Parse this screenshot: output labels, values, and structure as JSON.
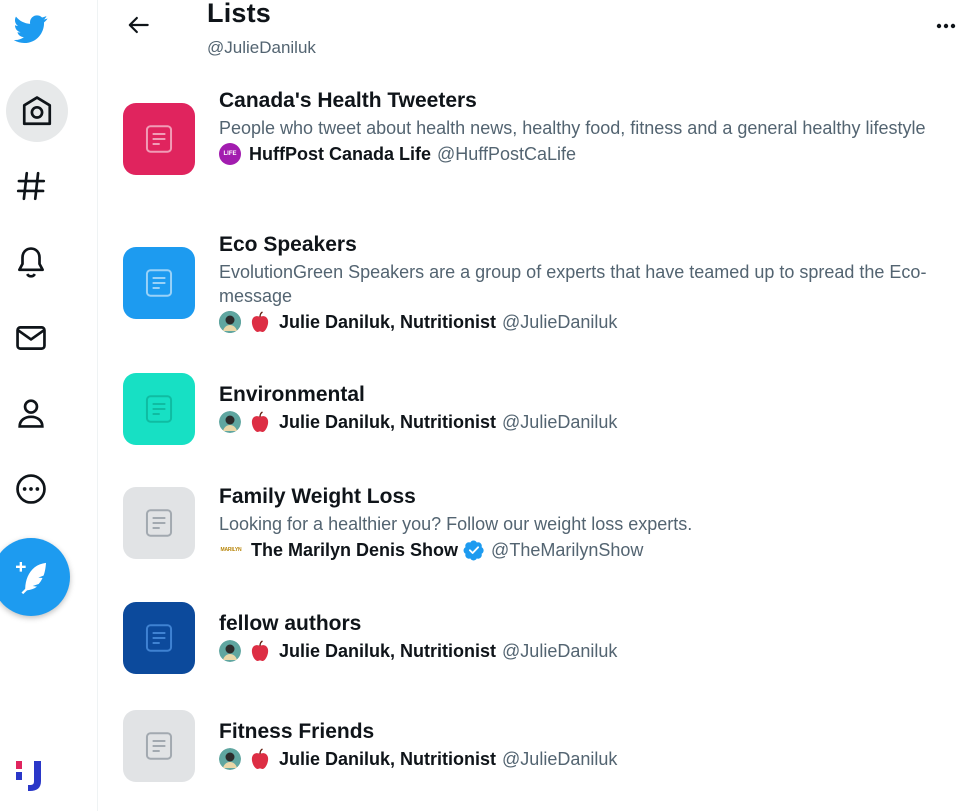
{
  "header": {
    "title": "Lists",
    "handle": "@JulieDaniluk"
  },
  "nav": {
    "items": [
      "twitter-logo",
      "home",
      "explore",
      "notifications",
      "messages",
      "profile",
      "more"
    ]
  },
  "colors": {
    "accent": "#1d9bf0",
    "thumb_pink": "#e0245e",
    "thumb_blue": "#1d9bf0",
    "thumb_teal": "#17e0c4",
    "thumb_gray": "#e1e3e5",
    "thumb_navy": "#0c4a9c"
  },
  "lists": [
    {
      "name": "Canada's Health Tweeters",
      "description": "People who tweet about health news, healthy food, fitness and a general healthy lifestyle",
      "owner_name": "HuffPost Canada Life",
      "owner_handle": "@HuffPostCaLife",
      "avatar_text": "LIFE",
      "thumb_color": "#e0245e"
    },
    {
      "name": "Eco Speakers",
      "description": "EvolutionGreen Speakers are a group of experts that have teamed up to spread the Eco-message",
      "owner_name": "Julie Daniluk, Nutritionist",
      "owner_handle": "@JulieDaniluk",
      "thumb_color": "#1d9bf0"
    },
    {
      "name": "Environmental",
      "owner_name": "Julie Daniluk, Nutritionist",
      "owner_handle": "@JulieDaniluk",
      "thumb_color": "#17e0c4"
    },
    {
      "name": "Family Weight Loss",
      "description": "Looking for a healthier you? Follow our weight loss experts.",
      "owner_name": "The Marilyn Denis Show",
      "owner_handle": "@TheMarilynShow",
      "avatar_text": "MARILYN",
      "thumb_color": "#e1e3e5"
    },
    {
      "name": "fellow authors",
      "owner_name": "Julie Daniluk, Nutritionist",
      "owner_handle": "@JulieDaniluk",
      "thumb_color": "#0c4a9c"
    },
    {
      "name": "Fitness Friends",
      "owner_name": "Julie Daniluk, Nutritionist",
      "owner_handle": "@JulieDaniluk",
      "thumb_color": "#e1e3e5"
    }
  ]
}
